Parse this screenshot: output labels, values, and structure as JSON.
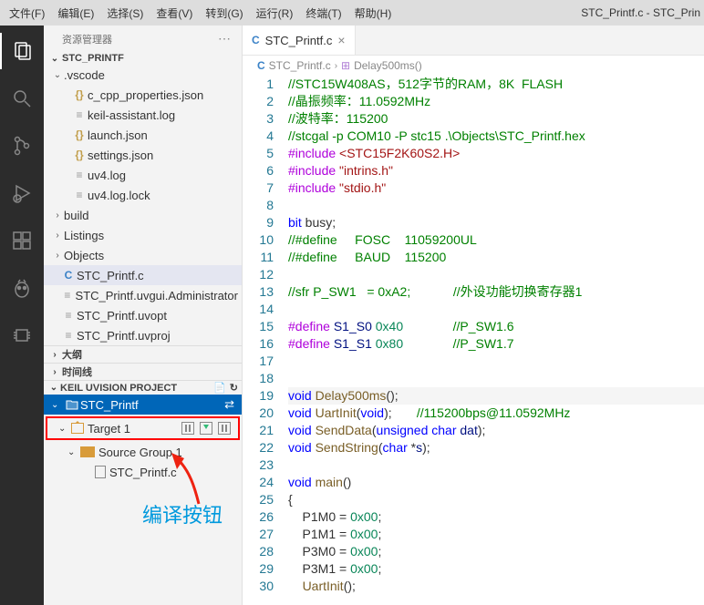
{
  "menubar": {
    "items": [
      "文件(F)",
      "编辑(E)",
      "选择(S)",
      "查看(V)",
      "转到(G)",
      "运行(R)",
      "终端(T)",
      "帮助(H)"
    ],
    "title": "STC_Printf.c - STC_Prin"
  },
  "explorer": {
    "title": "资源管理器",
    "project": "STC_PRINTF",
    "vscode": {
      "label": ".vscode",
      "files": [
        "c_cpp_properties.json",
        "keil-assistant.log",
        "launch.json",
        "settings.json",
        "uv4.log",
        "uv4.log.lock"
      ]
    },
    "folders": [
      "build",
      "Listings",
      "Objects"
    ],
    "rootFiles": [
      "STC_Printf.c",
      "STC_Printf.uvgui.Administrator",
      "STC_Printf.uvopt",
      "STC_Printf.uvproj"
    ],
    "outline": "大纲",
    "timeline": "时间线"
  },
  "keil": {
    "title": "KEIL UVISION PROJECT",
    "project": "STC_Printf",
    "target": "Target 1",
    "sourceGroup": "Source Group 1",
    "file": "STC_Printf.c"
  },
  "annotation": "编译按钮",
  "tabs": {
    "file": "STC_Printf.c"
  },
  "breadcrumb": {
    "file": "STC_Printf.c",
    "symbol": "Delay500ms()"
  },
  "code": {
    "lines": [
      {
        "n": 1,
        "frags": [
          {
            "t": "//STC15W408AS，512字节的RAM，8K  FLASH",
            "cls": "c"
          }
        ]
      },
      {
        "n": 2,
        "frags": [
          {
            "t": "//晶振频率：11.0592MHz",
            "cls": "c"
          }
        ]
      },
      {
        "n": 3,
        "frags": [
          {
            "t": "//波特率：115200",
            "cls": "c"
          }
        ]
      },
      {
        "n": 4,
        "frags": [
          {
            "t": "//stcgal -p COM10 -P stc15 .\\Objects\\STC_Printf.hex",
            "cls": "c"
          }
        ]
      },
      {
        "n": 5,
        "frags": [
          {
            "t": "#include ",
            "cls": "m"
          },
          {
            "t": "<STC15F2K60S2.H>",
            "cls": "s"
          }
        ]
      },
      {
        "n": 6,
        "frags": [
          {
            "t": "#include ",
            "cls": "m"
          },
          {
            "t": "\"intrins.h\"",
            "cls": "s"
          }
        ]
      },
      {
        "n": 7,
        "frags": [
          {
            "t": "#include ",
            "cls": "m"
          },
          {
            "t": "\"stdio.h\"",
            "cls": "s"
          }
        ]
      },
      {
        "n": 8,
        "frags": []
      },
      {
        "n": 9,
        "frags": [
          {
            "t": "bit",
            "cls": "k"
          },
          {
            "t": " busy;"
          }
        ]
      },
      {
        "n": 10,
        "frags": [
          {
            "t": "//#define     FOSC    11059200UL",
            "cls": "c"
          }
        ]
      },
      {
        "n": 11,
        "frags": [
          {
            "t": "//#define     BAUD    115200",
            "cls": "c"
          }
        ]
      },
      {
        "n": 12,
        "frags": []
      },
      {
        "n": 13,
        "frags": [
          {
            "t": "//sfr P_SW1   = 0xA2;            ",
            "cls": "c"
          },
          {
            "t": "//外设功能切换寄存器1",
            "cls": "c"
          }
        ]
      },
      {
        "n": 14,
        "frags": []
      },
      {
        "n": 15,
        "frags": [
          {
            "t": "#define ",
            "cls": "m"
          },
          {
            "t": "S1_S0",
            "cls": "v"
          },
          {
            "t": " "
          },
          {
            "t": "0x40",
            "cls": "n"
          },
          {
            "t": "              "
          },
          {
            "t": "//P_SW1.6",
            "cls": "c"
          }
        ]
      },
      {
        "n": 16,
        "frags": [
          {
            "t": "#define ",
            "cls": "m"
          },
          {
            "t": "S1_S1",
            "cls": "v"
          },
          {
            "t": " "
          },
          {
            "t": "0x80",
            "cls": "n"
          },
          {
            "t": "              "
          },
          {
            "t": "//P_SW1.7",
            "cls": "c"
          }
        ]
      },
      {
        "n": 17,
        "frags": []
      },
      {
        "n": 18,
        "frags": []
      },
      {
        "n": 19,
        "hl": true,
        "frags": [
          {
            "t": "void",
            "cls": "k"
          },
          {
            "t": " "
          },
          {
            "t": "Delay500ms",
            "cls": "f"
          },
          {
            "t": "();"
          }
        ]
      },
      {
        "n": 20,
        "frags": [
          {
            "t": "void",
            "cls": "k"
          },
          {
            "t": " "
          },
          {
            "t": "UartInit",
            "cls": "f"
          },
          {
            "t": "("
          },
          {
            "t": "void",
            "cls": "k"
          },
          {
            "t": ");       "
          },
          {
            "t": "//115200bps@11.0592MHz",
            "cls": "c"
          }
        ]
      },
      {
        "n": 21,
        "frags": [
          {
            "t": "void",
            "cls": "k"
          },
          {
            "t": " "
          },
          {
            "t": "SendData",
            "cls": "f"
          },
          {
            "t": "("
          },
          {
            "t": "unsigned",
            "cls": "k"
          },
          {
            "t": " "
          },
          {
            "t": "char",
            "cls": "k"
          },
          {
            "t": " "
          },
          {
            "t": "dat",
            "cls": "v"
          },
          {
            "t": ");"
          }
        ]
      },
      {
        "n": 22,
        "frags": [
          {
            "t": "void",
            "cls": "k"
          },
          {
            "t": " "
          },
          {
            "t": "SendString",
            "cls": "f"
          },
          {
            "t": "("
          },
          {
            "t": "char",
            "cls": "k"
          },
          {
            "t": " *"
          },
          {
            "t": "s",
            "cls": "v"
          },
          {
            "t": ");"
          }
        ]
      },
      {
        "n": 23,
        "frags": []
      },
      {
        "n": 24,
        "frags": [
          {
            "t": "void",
            "cls": "k"
          },
          {
            "t": " "
          },
          {
            "t": "main",
            "cls": "f"
          },
          {
            "t": "()"
          }
        ]
      },
      {
        "n": 25,
        "frags": [
          {
            "t": "{"
          }
        ]
      },
      {
        "n": 26,
        "frags": [
          {
            "t": "    P1M0 = "
          },
          {
            "t": "0x00",
            "cls": "n"
          },
          {
            "t": ";"
          }
        ]
      },
      {
        "n": 27,
        "frags": [
          {
            "t": "    P1M1 = "
          },
          {
            "t": "0x00",
            "cls": "n"
          },
          {
            "t": ";"
          }
        ]
      },
      {
        "n": 28,
        "frags": [
          {
            "t": "    P3M0 = "
          },
          {
            "t": "0x00",
            "cls": "n"
          },
          {
            "t": ";"
          }
        ]
      },
      {
        "n": 29,
        "frags": [
          {
            "t": "    P3M1 = "
          },
          {
            "t": "0x00",
            "cls": "n"
          },
          {
            "t": ";"
          }
        ]
      },
      {
        "n": 30,
        "frags": [
          {
            "t": "    "
          },
          {
            "t": "UartInit",
            "cls": "f"
          },
          {
            "t": "();"
          }
        ]
      }
    ]
  }
}
